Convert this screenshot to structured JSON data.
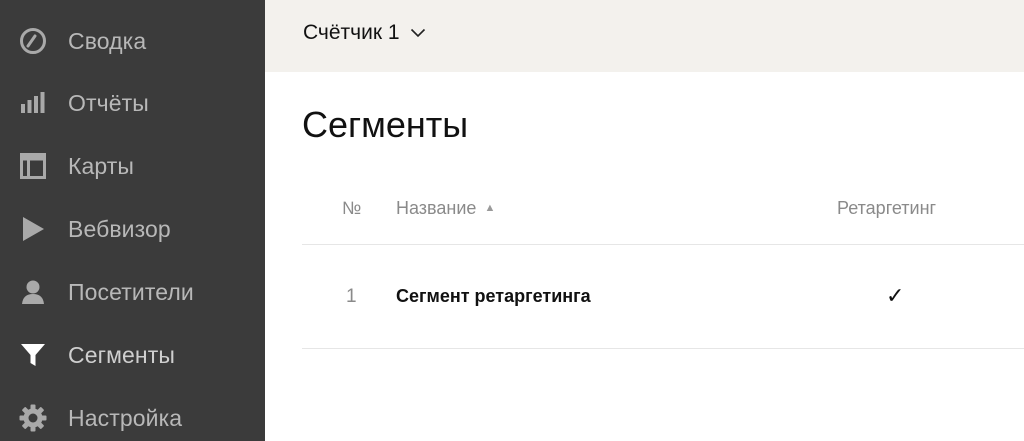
{
  "sidebar": {
    "items": [
      {
        "label": "Сводка",
        "icon": "dashboard-gauge-icon"
      },
      {
        "label": "Отчёты",
        "icon": "bar-chart-icon"
      },
      {
        "label": "Карты",
        "icon": "layout-map-icon"
      },
      {
        "label": "Вебвизор",
        "icon": "play-icon"
      },
      {
        "label": "Посетители",
        "icon": "user-icon"
      },
      {
        "label": "Сегменты",
        "icon": "filter-icon",
        "active": true
      },
      {
        "label": "Настройка",
        "icon": "gear-icon"
      }
    ],
    "colors": {
      "background": "#3b3b3b",
      "label": "#b8b8b8",
      "icon": "#a9a9a9",
      "active_icon": "#ffffff"
    }
  },
  "header": {
    "counter_label": "Счётчик 1",
    "chevron_icon": "chevron-down-icon",
    "background": "#f3f1ed"
  },
  "main": {
    "title": "Сегменты",
    "table": {
      "columns": {
        "number": "№",
        "name": "Название",
        "name_sort": "▲",
        "retargeting": "Ретаргетинг"
      },
      "rows": [
        {
          "number": "1",
          "name": "Сегмент ретаргетинга",
          "retargeting": "✓"
        }
      ]
    }
  }
}
